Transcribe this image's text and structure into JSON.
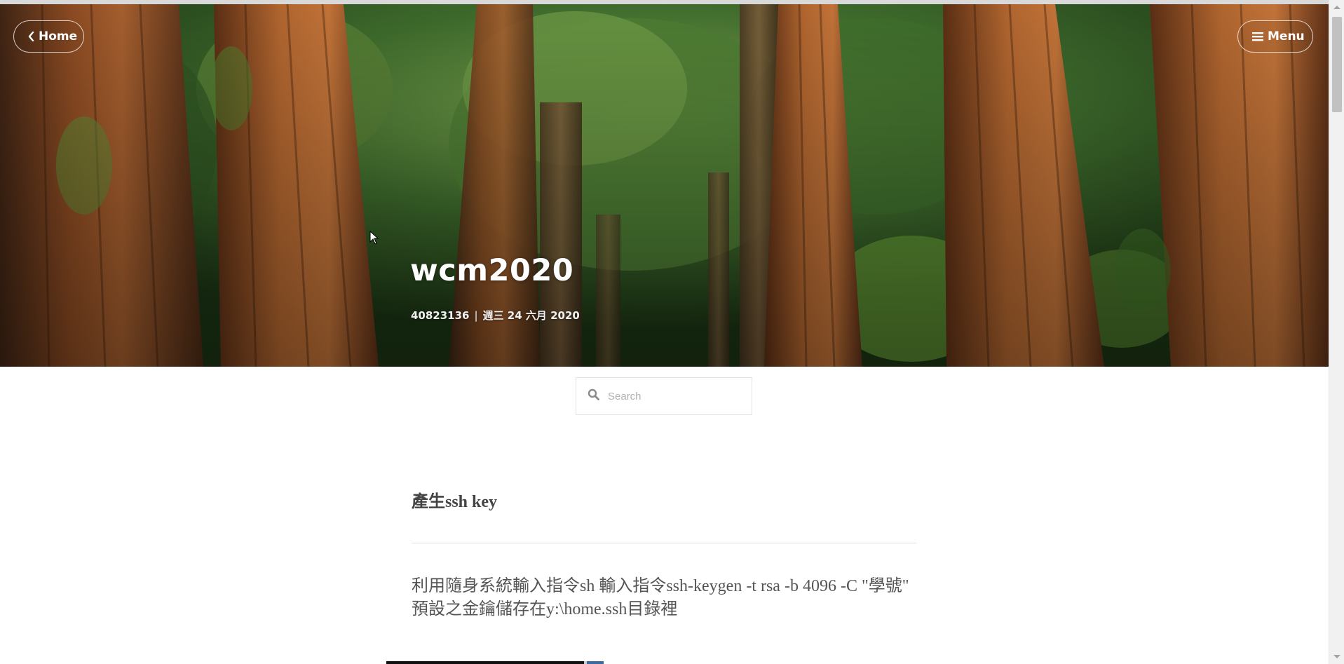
{
  "nav": {
    "home_label": "Home",
    "menu_label": "Menu"
  },
  "hero": {
    "title": "wcm2020",
    "author": "40823136",
    "separator": "|",
    "date": "週三 24 六月 2020"
  },
  "search": {
    "placeholder": "Search",
    "value": ""
  },
  "post": {
    "heading": "產生ssh key",
    "body_lines": [
      "利用隨身系統輸入指令sh 輸入指令ssh-keygen -t rsa -b 4096 -C \"學號\"",
      "預設之金鑰儲存在y:\\home.ssh目錄裡"
    ]
  },
  "icons": {
    "home": "chevron-left-icon",
    "menu": "hamburger-icon",
    "search": "search-icon"
  },
  "colors": {
    "hero_text": "#ffffff",
    "body_text": "#555555",
    "divider": "#dcdcdc"
  }
}
